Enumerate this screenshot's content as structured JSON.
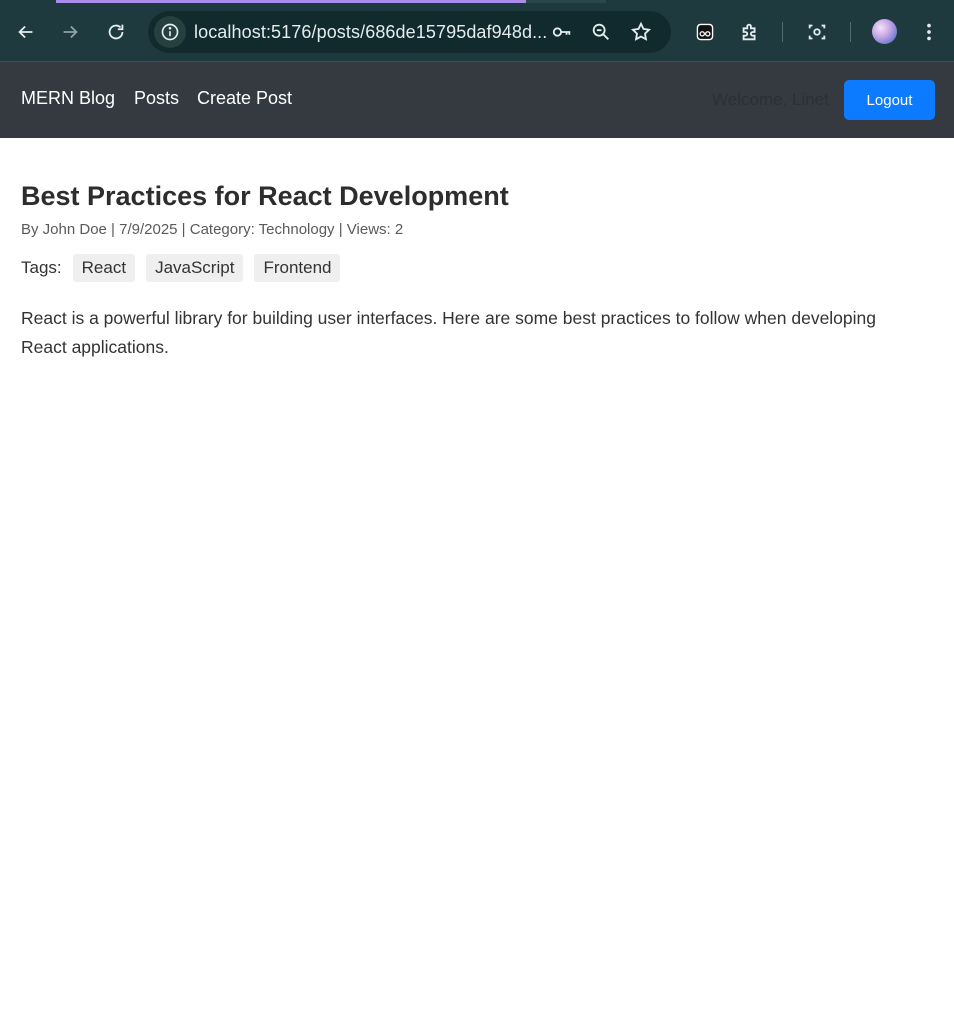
{
  "browser": {
    "url": "localhost:5176/posts/686de15795daf948d..."
  },
  "navbar": {
    "brand": "MERN Blog",
    "links": [
      "Posts",
      "Create Post"
    ],
    "welcome": "Welcome, Linet",
    "logout_label": "Logout"
  },
  "post": {
    "title": "Best Practices for React Development",
    "meta": "By John Doe | 7/9/2025 | Category: Technology | Views: 2",
    "tags_label": "Tags:",
    "tags": [
      "React",
      "JavaScript",
      "Frontend"
    ],
    "content": "React is a powerful library for building user interfaces. Here are some best practices to follow when developing React applications."
  },
  "icons": {
    "back": "back-arrow-icon",
    "forward": "forward-arrow-icon",
    "reload": "reload-icon",
    "site_info": "info-icon",
    "password": "key-icon",
    "zoom": "zoom-icon",
    "bookmark": "star-icon",
    "extension_ghost": "incognito-icon",
    "extensions": "puzzle-icon",
    "lens": "camera-search-icon",
    "menu": "more-vert-icon"
  },
  "colors": {
    "chrome_bg": "#1f3a3f",
    "navbar_bg": "#343a40",
    "logout_bg": "#0d7bff",
    "tag_bg": "#efefef"
  }
}
